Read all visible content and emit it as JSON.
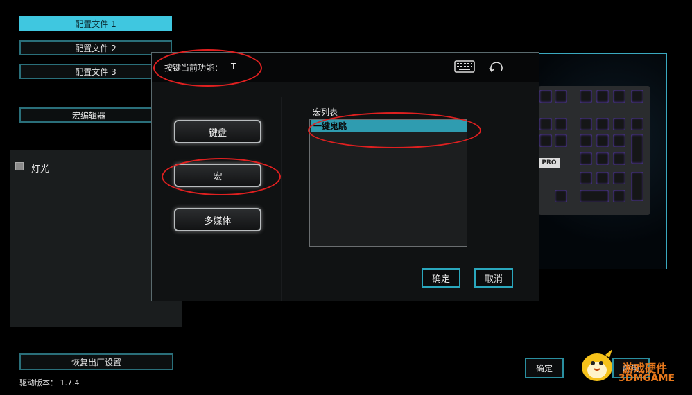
{
  "sidebar": {
    "profiles": [
      "配置文件 1",
      "配置文件 2",
      "配置文件 3"
    ],
    "macro_editor": "宏编辑器",
    "lighting_label": "灯光",
    "reset_button": "恢复出厂设置",
    "driver_version": "驱动版本：  1.7.4"
  },
  "dialog": {
    "current_function_label": "按键当前功能：",
    "current_function_value": "T",
    "icons": [
      "keyboard-icon",
      "refresh-icon"
    ],
    "categories": [
      "键盘",
      "宏",
      "多媒体"
    ],
    "macro_list_title": "宏列表",
    "macro_items": [
      "一键鬼跳"
    ],
    "selected_macro": "一键鬼跳",
    "confirm": "确定",
    "cancel": "取消"
  },
  "bottom": {
    "confirm": "确定",
    "apply": "应用"
  },
  "watermark": {
    "line1": "游戏硬件",
    "line2": "3DMGAME"
  },
  "colors": {
    "accent": "#3fc7e0",
    "highlight_oval": "#e02020",
    "selected_row": "#2f9cb0"
  }
}
